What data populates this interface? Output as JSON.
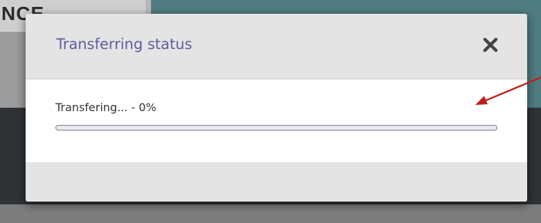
{
  "background": {
    "heading_fragment": "NCE"
  },
  "modal": {
    "title": "Transferring status",
    "close_icon": "close-icon",
    "progress": {
      "label": "Transfering... - 0%",
      "value": 0
    }
  },
  "colors": {
    "title": "#5a5f9e",
    "annotation_arrow": "#c0201b",
    "close_icon": "#444444"
  }
}
